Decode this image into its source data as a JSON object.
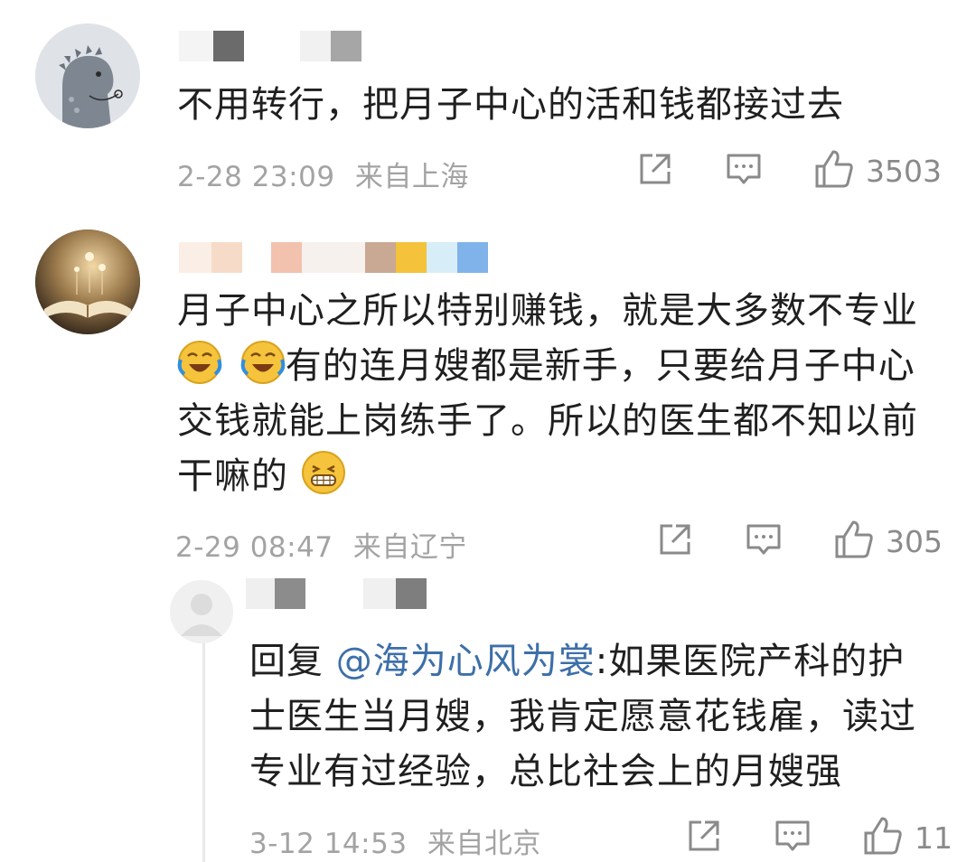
{
  "comments": [
    {
      "avatar": "dinosaur-avatar",
      "text": "不用转行，把月子中心的活和钱都接过去",
      "time": "2-28 23:09",
      "location": "来自上海",
      "likes": "3503"
    },
    {
      "avatar": "book-avatar",
      "text_line1": "月子中心之所以特别赚钱，就是大多数不专业",
      "text_line2": "有的连月嫂都是新手，只要给月子中心",
      "text_line3": "交钱就能上岗练手了。所以的医生都不知以前",
      "text_line4": "干嘛的",
      "time": "2-29 08:47",
      "location": "来自辽宁",
      "likes": "305"
    }
  ],
  "reply": {
    "avatar": "default-avatar",
    "prefix": "回复 ",
    "mention": "@海为心风为裳",
    "text_after_mention": ":如果医院产科的护",
    "text_line2": "士医生当月嫂，我肯定愿意花钱雇，读过",
    "text_line3": "专业有过经验，总比社会上的月嫂强",
    "time": "3-12 14:53",
    "location": "来自北京",
    "likes": "11"
  },
  "icons": {
    "share": "share-icon",
    "comment": "comment-icon",
    "like": "thumbs-up-icon",
    "emoji_cry": "laugh-cry-emoji-icon",
    "emoji_grin": "grin-emoji-icon"
  },
  "colors": {
    "text": "#1f1f1f",
    "meta": "#a3a3a3",
    "mention": "#3d6fa8",
    "icon": "#8a8a8a"
  }
}
